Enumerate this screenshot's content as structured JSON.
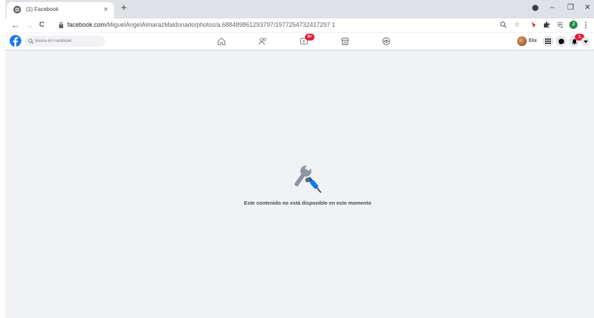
{
  "browser": {
    "tab_title": "(1) Facebook",
    "tab_close": "×",
    "new_tab": "+",
    "window_controls": {
      "minimize": "–",
      "maximize": "❐",
      "close": "✕"
    },
    "nav": {
      "back": "←",
      "forward": "→",
      "reload": "C"
    },
    "url_host": "facebook.com",
    "url_path": "/MiguelAngelAlmarazMaldonado/photos/a.688489861293797/1977254732417297 1",
    "profile_initial": "J"
  },
  "facebook": {
    "search_placeholder": "Busca en Facebook",
    "watch_badge": "9+",
    "profile_name": "Eloi",
    "notifications_badge": "1",
    "message": "Este contenido no está disponible en este momento"
  },
  "colors": {
    "fb_blue": "#1877f2",
    "badge_red": "#e41e3f",
    "page_bg": "#f0f2f5",
    "avatar_green": "#1e8e3e"
  }
}
